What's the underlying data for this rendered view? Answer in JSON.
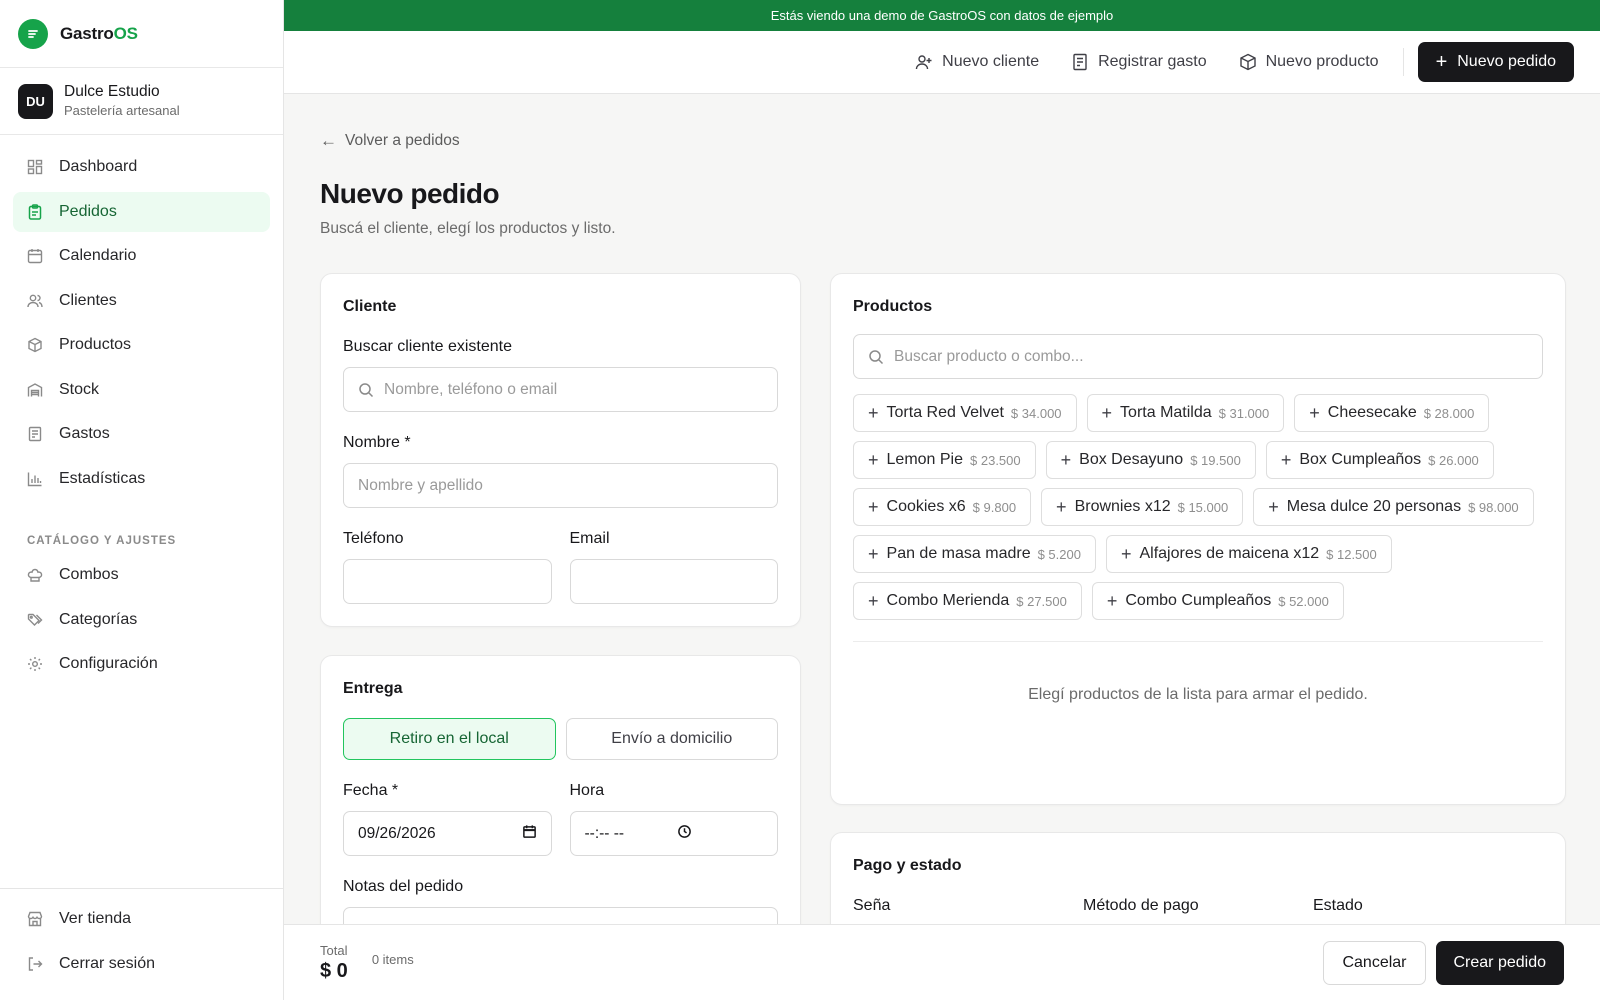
{
  "colors": {
    "brand": "#16a34a",
    "demo_bar": "#15803d",
    "dark": "#18181b",
    "active_bg": "#ecfbf1"
  },
  "brand": {
    "prefix": "Gastro",
    "accent": "OS"
  },
  "business": {
    "initials": "DU",
    "name": "Dulce Estudio",
    "subtitle": "Pastelería artesanal"
  },
  "sidebar": {
    "items": [
      {
        "label": "Dashboard",
        "icon": "grid-icon"
      },
      {
        "label": "Pedidos",
        "icon": "clipboard-icon",
        "active": true
      },
      {
        "label": "Calendario",
        "icon": "calendar-icon"
      },
      {
        "label": "Clientes",
        "icon": "users-icon"
      },
      {
        "label": "Productos",
        "icon": "box-icon"
      },
      {
        "label": "Stock",
        "icon": "warehouse-icon"
      },
      {
        "label": "Gastos",
        "icon": "receipt-icon"
      },
      {
        "label": "Estadísticas",
        "icon": "bar-chart-icon"
      }
    ],
    "section_label": "CATÁLOGO Y AJUSTES",
    "settings_items": [
      {
        "label": "Combos",
        "icon": "chef-hat-icon"
      },
      {
        "label": "Categorías",
        "icon": "tags-icon"
      },
      {
        "label": "Configuración",
        "icon": "gear-icon"
      }
    ],
    "footer": {
      "store": "Ver tienda",
      "logout": "Cerrar sesión"
    }
  },
  "demo_banner": "Estás viendo una demo de GastroOS con datos de ejemplo",
  "topbar": {
    "new_client": "Nuevo cliente",
    "register_expense": "Registrar gasto",
    "new_product": "Nuevo producto",
    "new_order": "Nuevo pedido"
  },
  "page": {
    "back": "Volver a pedidos",
    "title": "Nuevo pedido",
    "subtitle": "Buscá el cliente, elegí los productos y listo."
  },
  "cliente": {
    "title": "Cliente",
    "search_label": "Buscar cliente existente",
    "search_placeholder": "Nombre, teléfono o email",
    "name_label": "Nombre *",
    "name_placeholder": "Nombre y apellido",
    "phone_label": "Teléfono",
    "email_label": "Email"
  },
  "entrega": {
    "title": "Entrega",
    "options": [
      "Retiro en el local",
      "Envío a domicilio"
    ],
    "selected": 0,
    "date_label": "Fecha *",
    "date_value": "09/26/2026",
    "time_label": "Hora",
    "time_value": "--:-- --",
    "notes_label": "Notas del pedido"
  },
  "productos": {
    "title": "Productos",
    "search_placeholder": "Buscar producto o combo...",
    "items": [
      {
        "name": "Torta Red Velvet",
        "price": "$ 34.000"
      },
      {
        "name": "Torta Matilda",
        "price": "$ 31.000"
      },
      {
        "name": "Cheesecake",
        "price": "$ 28.000"
      },
      {
        "name": "Lemon Pie",
        "price": "$ 23.500"
      },
      {
        "name": "Box Desayuno",
        "price": "$ 19.500"
      },
      {
        "name": "Box Cumpleaños",
        "price": "$ 26.000"
      },
      {
        "name": "Cookies x6",
        "price": "$ 9.800"
      },
      {
        "name": "Brownies x12",
        "price": "$ 15.000"
      },
      {
        "name": "Mesa dulce 20 personas",
        "price": "$ 98.000"
      },
      {
        "name": "Pan de masa madre",
        "price": "$ 5.200"
      },
      {
        "name": "Alfajores de maicena x12",
        "price": "$ 12.500"
      },
      {
        "name": "Combo Merienda",
        "price": "$ 27.500"
      },
      {
        "name": "Combo Cumpleaños",
        "price": "$ 52.000"
      }
    ],
    "empty": "Elegí productos de la lista para armar el pedido."
  },
  "pago": {
    "title": "Pago y estado",
    "deposit_label": "Seña",
    "method_label": "Método de pago",
    "status_label": "Estado"
  },
  "footer": {
    "total_label": "Total",
    "total_value": "$ 0",
    "items_count": "0 items",
    "cancel": "Cancelar",
    "create": "Crear pedido"
  }
}
